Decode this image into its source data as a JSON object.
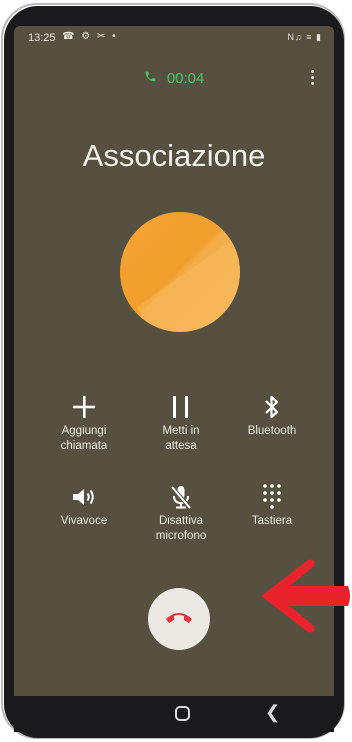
{
  "status_bar": {
    "time": "13:25",
    "left_icons": "☎ ⚙ ✂ •",
    "right_icons": "N♫ ≡ ▮"
  },
  "call": {
    "timer": "00:04",
    "contact_name": "Associazione"
  },
  "controls": [
    {
      "label": "Aggiungi\nchiamata",
      "icon": "add-icon"
    },
    {
      "label": "Metti in\nattesa",
      "icon": "pause-icon"
    },
    {
      "label": "Bluetooth",
      "icon": "bluetooth-icon"
    },
    {
      "label": "Vivavoce",
      "icon": "speaker-icon"
    },
    {
      "label": "Disattiva\nmicrofono",
      "icon": "mic-off-icon"
    },
    {
      "label": "Tastiera",
      "icon": "keypad-icon"
    }
  ],
  "colors": {
    "screen_bg": "#55503f",
    "timer_green": "#48c46a",
    "end_call_red": "#e0343c",
    "arrow_red": "#e8232c",
    "avatar_orange": "#f3a63d"
  }
}
